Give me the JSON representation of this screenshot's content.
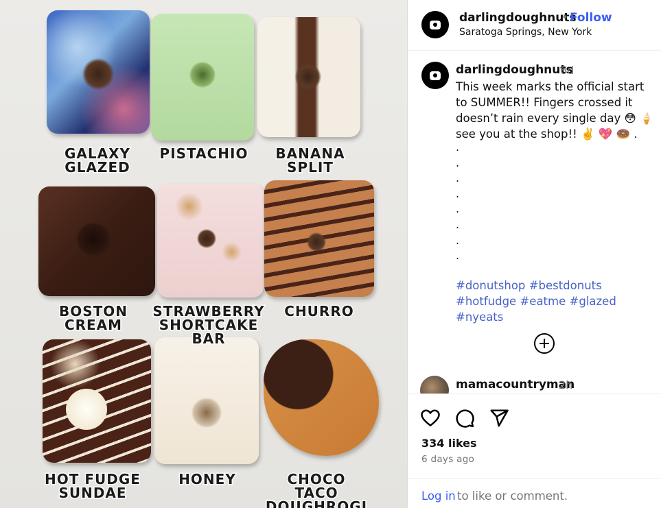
{
  "photo": {
    "labels": [
      "GALAXY\nGLAZED",
      "PISTACHIO",
      "BANANA\nSPLIT",
      "BOSTON\nCREAM",
      "STRAWBERRY\nSHORTCAKE BAR",
      "CHURRO",
      "HOT FUDGE\nSUNDAE",
      "HONEY",
      "CHOCO TACO\nDOUGHROGI"
    ]
  },
  "header": {
    "username": "darlingdoughnuts",
    "separator": "•",
    "follow_label": "Follow",
    "location": "Saratoga Springs, New York",
    "avatar_icon": "doughnut-logo-icon"
  },
  "caption": {
    "username": "darlingdoughnuts",
    "time": "6d",
    "text": "This week marks the official start to SUMMER!! Fingers crossed it doesn’t rain every single day 😳 🍦 see you at the shop!! ✌️ 💖 🍩 .",
    "dots": ".\n.\n.\n.\n.\n.\n.\n.",
    "hashtags": [
      "#donutshop",
      "#bestdonuts",
      "#hotfudge",
      "#eatme",
      "#glazed",
      "#nyeats"
    ],
    "more_icon": "plus-circle-icon"
  },
  "comment": {
    "username": "mamacountryman",
    "time": "2h"
  },
  "actions": {
    "like_icon": "heart-icon",
    "comment_icon": "comment-icon",
    "share_icon": "send-icon",
    "likes": "334 likes",
    "posted": "6 days ago",
    "login_link": "Log in",
    "login_rest": "to like or comment."
  },
  "colors": {
    "link_blue": "#3b5df0",
    "hashtag_blue": "#4762c9",
    "muted_gray": "#737373"
  }
}
